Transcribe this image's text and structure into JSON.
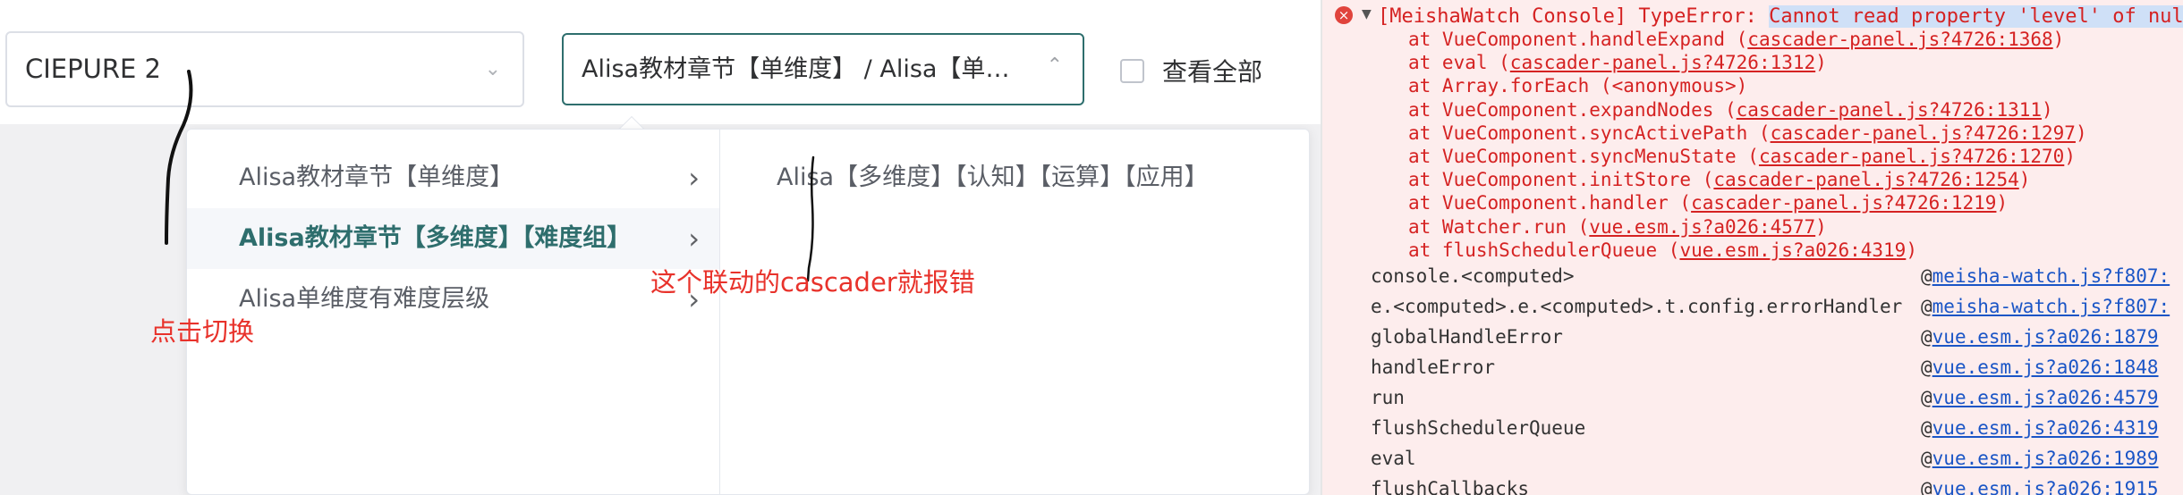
{
  "app": {
    "select_left_value": "CIEPURE 2",
    "select_right_value": "Alisa教材章节【单维度】 / Alisa【单维度】",
    "view_all_label": "查看全部",
    "cascader": {
      "column1": [
        {
          "label": "Alisa教材章节【单维度】",
          "active": false
        },
        {
          "label": "Alisa教材章节【多维度】【难度组】",
          "active": true
        },
        {
          "label": "Alisa单维度有难度层级",
          "active": false
        }
      ],
      "column2": [
        {
          "label": "Alisa【多维度】【认知】【运算】【应用】"
        }
      ]
    },
    "annotations": {
      "click_switch": "点击切换",
      "cascader_error": "这个联动的cascader就报错"
    },
    "accent_color": "#2e6e6d",
    "annotation_color": "#e8322b"
  },
  "console": {
    "error_prefix": "[MeishaWatch Console] TypeError: ",
    "error_highlight": "Cannot read property 'level' of null",
    "stack": [
      {
        "at": "at VueComponent.handleExpand (",
        "loc": "cascader-panel.js?4726:1368",
        "end": ")"
      },
      {
        "at": "at eval (",
        "loc": "cascader-panel.js?4726:1312",
        "end": ")"
      },
      {
        "at": "at Array.forEach (<anonymous>)",
        "loc": "",
        "end": ""
      },
      {
        "at": "at VueComponent.expandNodes (",
        "loc": "cascader-panel.js?4726:1311",
        "end": ")"
      },
      {
        "at": "at VueComponent.syncActivePath (",
        "loc": "cascader-panel.js?4726:1297",
        "end": ")"
      },
      {
        "at": "at VueComponent.syncMenuState (",
        "loc": "cascader-panel.js?4726:1270",
        "end": ")"
      },
      {
        "at": "at VueComponent.initStore (",
        "loc": "cascader-panel.js?4726:1254",
        "end": ")"
      },
      {
        "at": "at VueComponent.handler (",
        "loc": "cascader-panel.js?4726:1219",
        "end": ")"
      },
      {
        "at": "at Watcher.run (",
        "loc": "vue.esm.js?a026:4577",
        "end": ")"
      },
      {
        "at": "at flushSchedulerQueue (",
        "loc": "vue.esm.js?a026:4319",
        "end": ")"
      }
    ],
    "handlers": [
      {
        "fn": "console.<computed>",
        "src": "meisha-watch.js?f807:"
      },
      {
        "fn": "e.<computed>.e.<computed>.t.config.errorHandler",
        "src": "meisha-watch.js?f807:"
      },
      {
        "fn": "globalHandleError",
        "src": "vue.esm.js?a026:1879"
      },
      {
        "fn": "handleError",
        "src": "vue.esm.js?a026:1848"
      },
      {
        "fn": "run",
        "src": "vue.esm.js?a026:4579"
      },
      {
        "fn": "flushSchedulerQueue",
        "src": "vue.esm.js?a026:4319"
      },
      {
        "fn": "eval",
        "src": "vue.esm.js?a026:1989"
      },
      {
        "fn": "flushCallbacks",
        "src": "vue.esm.js?a026:1915"
      }
    ],
    "error_icon": "error-circle-icon",
    "error_color": "#d52222"
  }
}
